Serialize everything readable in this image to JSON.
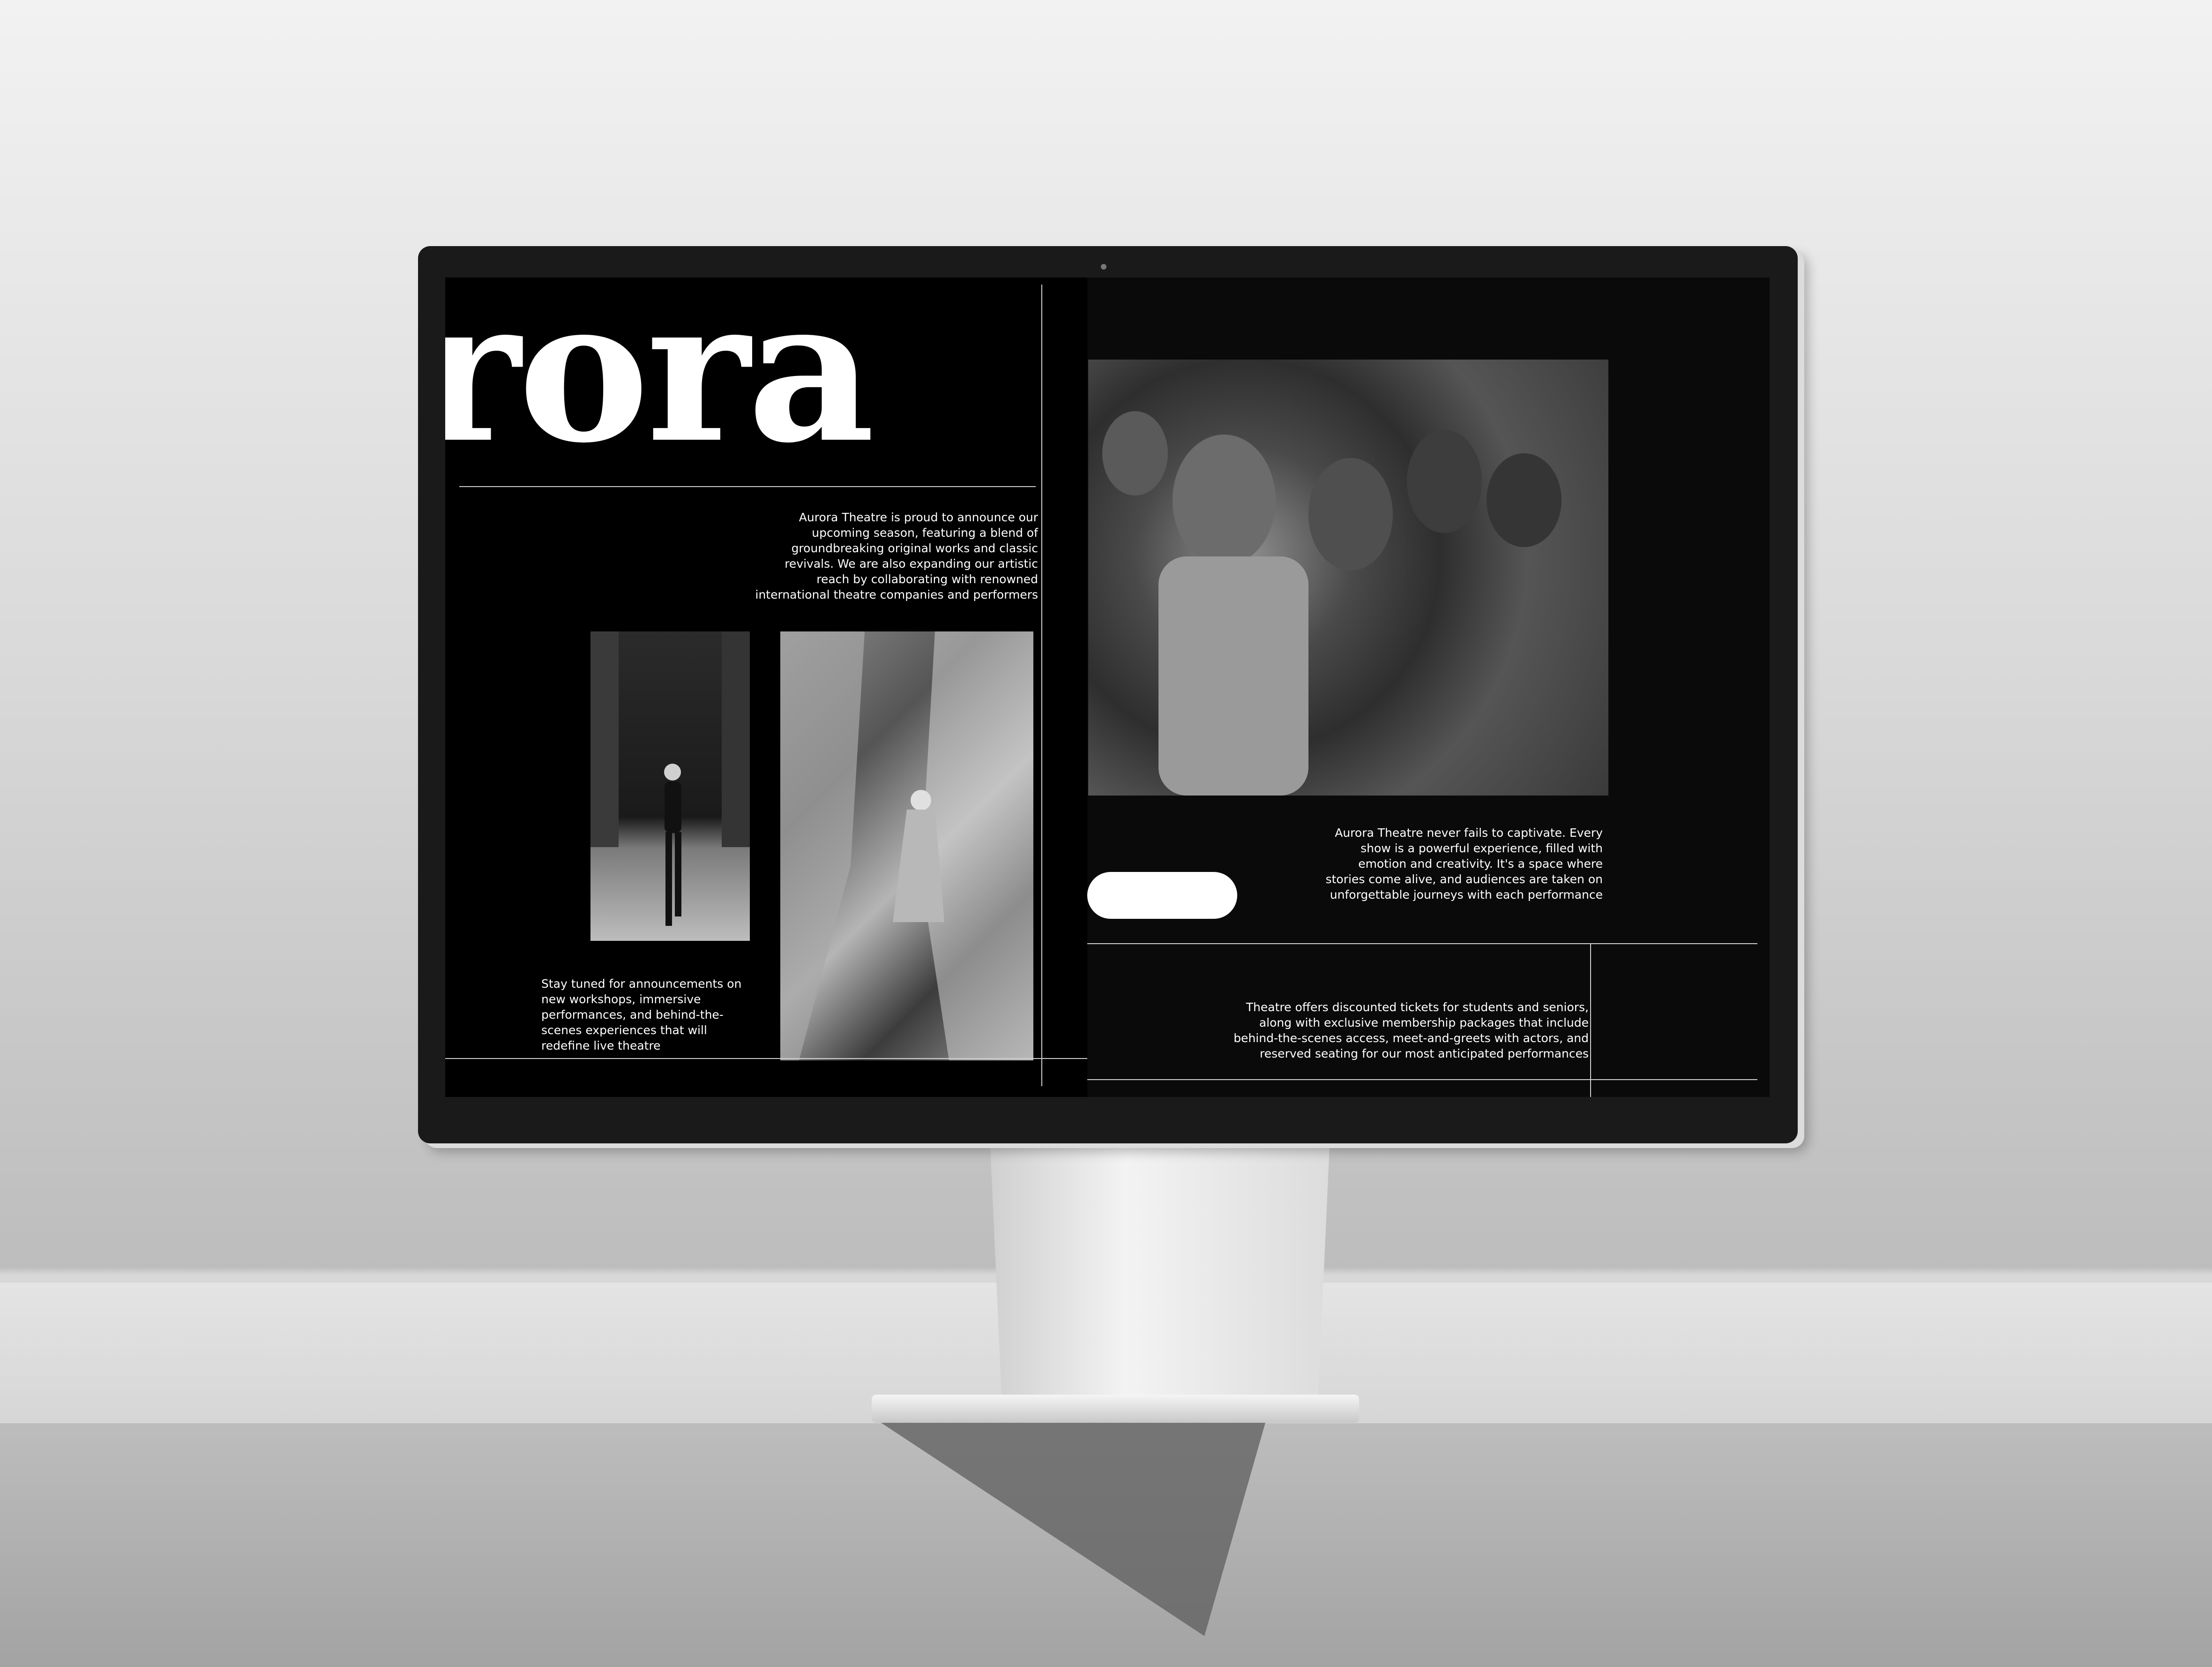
{
  "hero": {
    "word": "rora"
  },
  "left_panel": {
    "intro_text": "Aurora Theatre is proud to announce our upcoming season, featuring a blend of groundbreaking original works and classic revivals. We are also expanding our artistic reach by collaborating with renowned international theatre companies and performers",
    "announcement_text": "Stay tuned for announcements on new workshops, immersive performances, and behind-the-scenes experiences that will redefine live theatre"
  },
  "right_panel": {
    "captivate_text": "Aurora Theatre never fails to captivate. Every show is a powerful experience, filled with emotion and creativity. It's a space where stories come alive, and audiences are taken on unforgettable journeys with each performance",
    "tickets_text": "Theatre offers discounted tickets for students and seniors, along with exclusive membership packages that include behind-the-scenes access, meet-and-greets with actors, and reserved seating for our most anticipated performances"
  },
  "colors": {
    "screen_background": "#000000",
    "text": "#ffffff",
    "rule_lines": "#cfcfcf",
    "button": "#ffffff"
  }
}
